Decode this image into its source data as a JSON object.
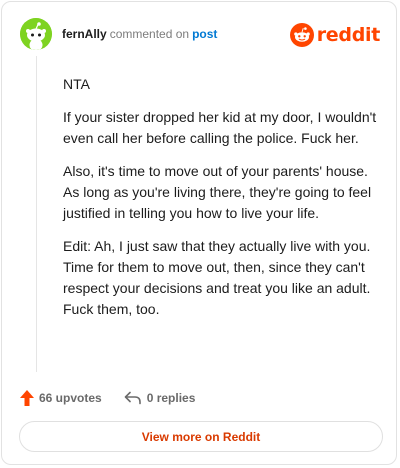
{
  "comment": {
    "username": "fernAlly",
    "action": "commented on",
    "target": "post",
    "paragraphs": [
      "NTA",
      "If your sister dropped her kid at my door, I wouldn't even call her before calling the police. Fuck her.",
      "Also, it's time to move out of your parents' house. As long as you're living there, they're going to feel justified in telling you how to live your life.",
      "Edit: Ah, I just saw that they actually live with you. Time for them to move out, then, since they can't respect your decisions and treat you like an adult. Fuck them, too."
    ]
  },
  "brand": {
    "name": "reddit",
    "color": "#ff4500"
  },
  "actions": {
    "upvotes": "66 upvotes",
    "replies": "0 replies"
  },
  "view_more": "View more on Reddit",
  "colors": {
    "upvote_arrow": "#ff4500",
    "link": "#0079d3",
    "view_more_text": "#d93a00",
    "avatar_bg": "#7ed321"
  },
  "icons": {
    "avatar": "snoo-avatar-icon",
    "brand": "reddit-snoo-logo-icon",
    "upvote": "upvote-arrow-icon",
    "reply": "reply-arrow-icon"
  }
}
